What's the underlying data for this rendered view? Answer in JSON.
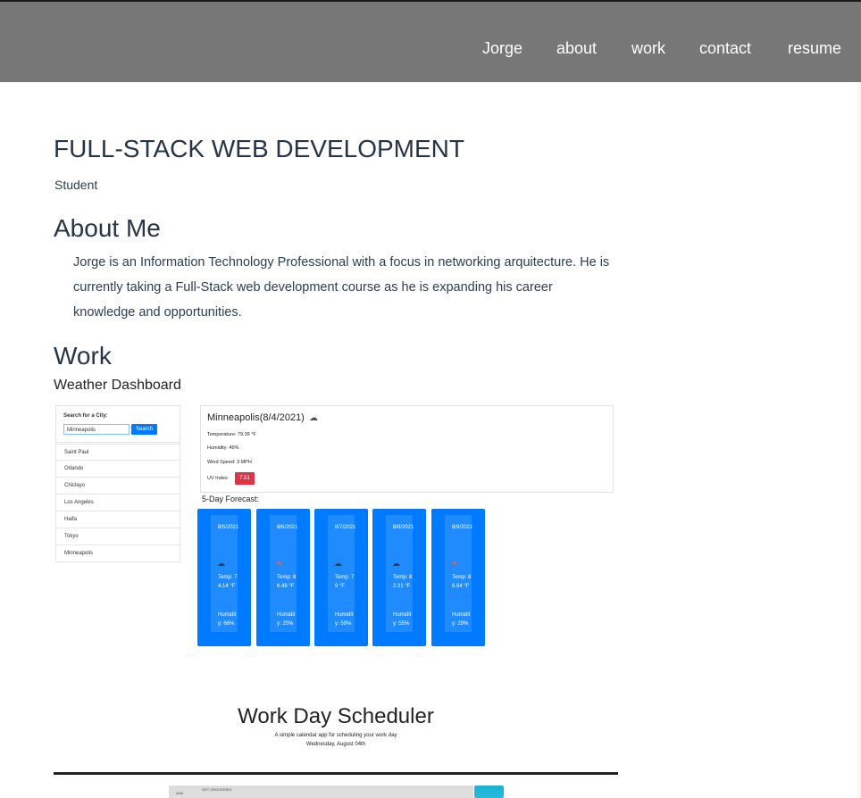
{
  "nav": {
    "brand": "Jorge",
    "links": [
      "about",
      "work",
      "contact",
      "resume"
    ]
  },
  "header": {
    "title": "FULL-STACK WEB DEVELOPMENT",
    "subtitle": "Student"
  },
  "about": {
    "heading": "About Me",
    "text": "Jorge is an Information Technology Professional with a focus in networking arquitecture. He is currently taking a Full-Stack web development course as he is expanding his career knowledge and opportunities."
  },
  "work": {
    "heading": "Work",
    "projects": [
      {
        "title": "Weather Dashboard",
        "screenshot": {
          "search_label": "Search for a City:",
          "search_value": "Minneapolis",
          "search_button": "Search",
          "cities": [
            "Saint Paul",
            "Orlando",
            "Chiclayo",
            "Los Angeles",
            "Haifa",
            "Tokyo",
            "Minneapolis"
          ],
          "current_city": "Minneapolis(8/4/2021)",
          "temperature": "Temperature: 79.39 °F",
          "humidity": "Humidity: 49%",
          "wind": "Wind Speed: 3 MPH",
          "uv_label": "UV Index:",
          "uv_value": "7.51",
          "forecast_title": "5-Day Forecast:",
          "forecast": [
            {
              "date": "8/5/2021",
              "icon": "☁",
              "temp": "Temp: 74.14 °F",
              "humidity": "Humidity: 66%"
            },
            {
              "date": "8/6/2021",
              "icon": "☀",
              "temp": "Temp: 86.48 °F",
              "humidity": "Humidity: 25%"
            },
            {
              "date": "8/7/2021",
              "icon": "☁",
              "temp": "Temp: 79 °F",
              "humidity": "Humidity: 59%"
            },
            {
              "date": "8/8/2021",
              "icon": "☁",
              "temp": "Temp: 82.31 °F",
              "humidity": "Humidity: 55%"
            },
            {
              "date": "8/9/2021",
              "icon": "☀",
              "temp": "Temp: 86.94 °F",
              "humidity": "Humidity: 29%"
            }
          ]
        }
      },
      {
        "title": "Work Day Scheduler",
        "screenshot": {
          "subtitle": "A simple calendar app for scheduling your work day",
          "date": "Wednesday, August 04th",
          "hour": "9AM",
          "task": "GET GROCERIES"
        }
      }
    ]
  },
  "colors": {
    "navbar": "#777777",
    "accent": "#007bff",
    "uv": "#dc3545"
  }
}
